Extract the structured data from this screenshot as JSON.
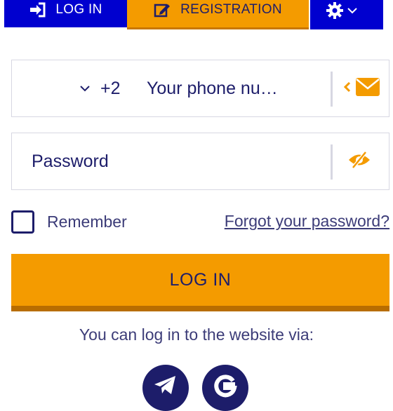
{
  "tabs": {
    "login_label": "LOG IN",
    "registration_label": "REGISTRATION"
  },
  "phone": {
    "country_code": "+2",
    "placeholder": "Your phone nu…"
  },
  "password": {
    "placeholder": "Password"
  },
  "remember_label": "Remember",
  "forgot_label": "Forgot your password?",
  "submit_label": "LOG IN",
  "social_prompt": "You can log in to the website via:",
  "colors": {
    "brand_blue": "#0000cf",
    "accent_orange": "#f49b00",
    "text_navy": "#1d1d6a"
  },
  "icons": {
    "login_tab": "sign-in-icon",
    "registration_tab": "edit-icon",
    "settings_tab": "gear-icon",
    "phone_toggle": "envelope-icon",
    "password_toggle": "eye-slash-icon",
    "socials": [
      "telegram-icon",
      "google-icon"
    ]
  }
}
